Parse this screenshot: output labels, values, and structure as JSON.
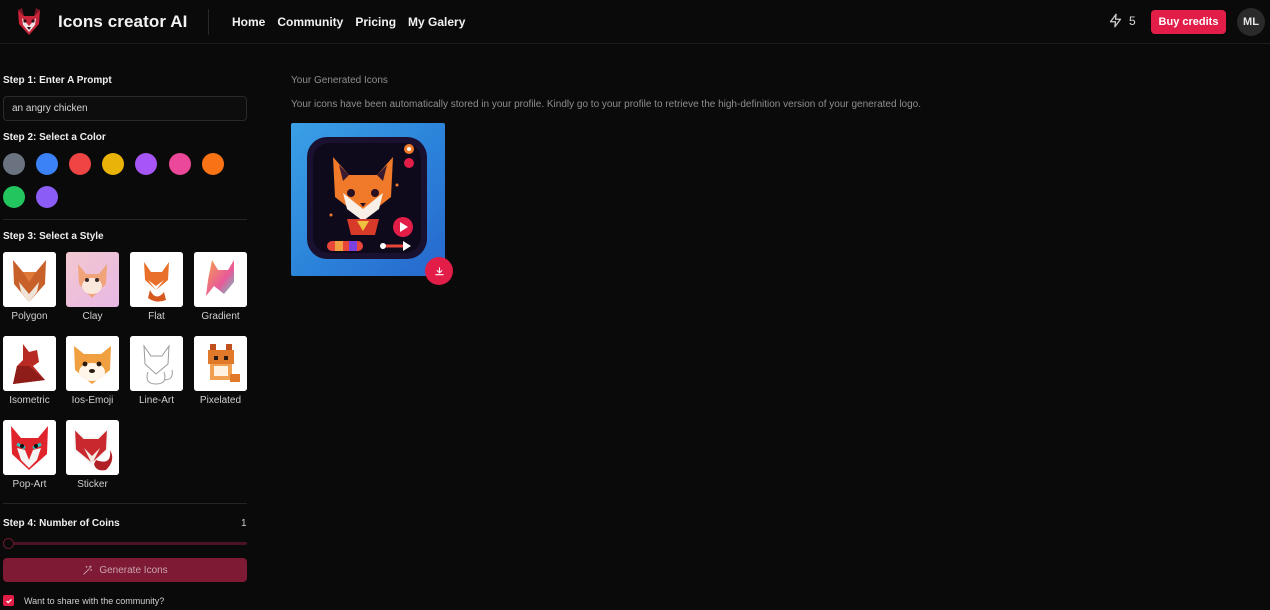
{
  "header": {
    "brand": "Icons creator AI",
    "nav": [
      "Home",
      "Community",
      "Pricing",
      "My Galery"
    ],
    "credits": "5",
    "buy_label": "Buy credits",
    "avatar_initials": "ML",
    "accent": "#e11d48"
  },
  "sidebar": {
    "step1": "Step 1: Enter A Prompt",
    "prompt_value": "an angry chicken",
    "step2": "Step 2: Select a Color",
    "colors": [
      "#6b7280",
      "#3b82f6",
      "#ef4444",
      "#eab308",
      "#a855f7",
      "#ec4899",
      "#f97316",
      "#22c55e",
      "#8b5cf6"
    ],
    "step3": "Step 3: Select a Style",
    "styles": [
      "Polygon",
      "Clay",
      "Flat",
      "Gradient",
      "Isometric",
      "Ios-Emoji",
      "Line-Art",
      "Pixelated",
      "Pop-Art",
      "Sticker"
    ],
    "step4": "Step 4: Number of Coins",
    "coins": "1",
    "generate_label": "Generate Icons",
    "share_label": "Want to share with the community?"
  },
  "main": {
    "title": "Your Generated Icons",
    "note": "Your icons have been automatically stored in your profile. Kindly go to your profile to retrieve the high-definition version of your generated logo."
  },
  "icons": {
    "logo": "fox-logo-icon",
    "credits": "lightning-icon",
    "generate": "magic-wand-icon",
    "download": "download-icon",
    "checkbox": "check-icon"
  }
}
